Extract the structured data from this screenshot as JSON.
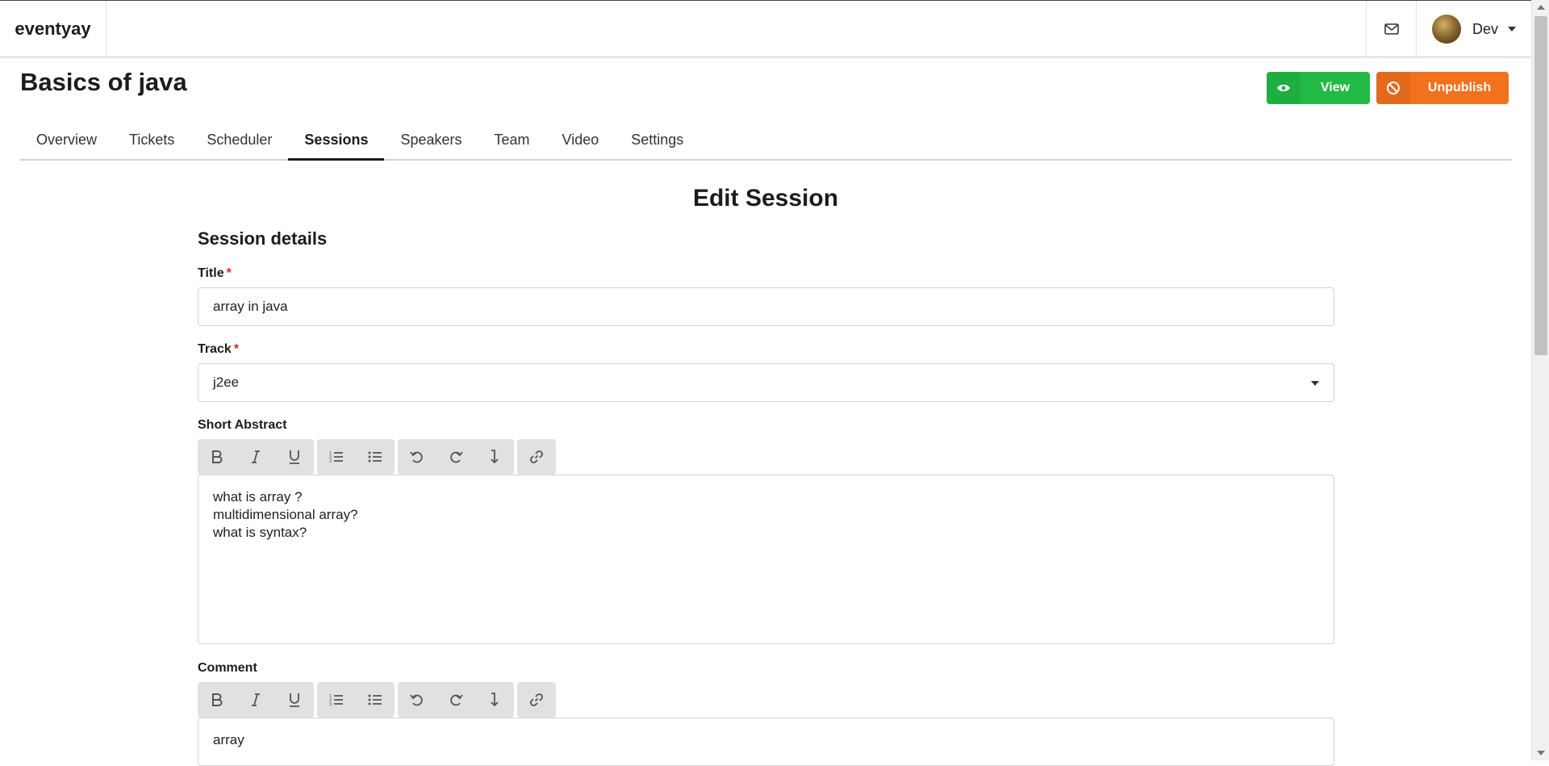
{
  "app": {
    "brand": "eventyay"
  },
  "user": {
    "name": "Dev"
  },
  "event": {
    "title": "Basics of java"
  },
  "actions": {
    "view_label": "View",
    "unpublish_label": "Unpublish"
  },
  "tabs": [
    {
      "label": "Overview"
    },
    {
      "label": "Tickets"
    },
    {
      "label": "Scheduler"
    },
    {
      "label": "Sessions",
      "active": true
    },
    {
      "label": "Speakers"
    },
    {
      "label": "Team"
    },
    {
      "label": "Video"
    },
    {
      "label": "Settings"
    }
  ],
  "form": {
    "heading": "Edit Session",
    "section": "Session details",
    "title_label": "Title",
    "title_value": "array in java",
    "track_label": "Track",
    "track_value": "j2ee",
    "abstract_label": "Short Abstract",
    "abstract_lines": [
      "what is array ?",
      "multidimensional array?",
      "what is syntax?"
    ],
    "comment_label": "Comment",
    "comment_value": "array",
    "required_mark": "*"
  },
  "colors": {
    "view": "#21ba45",
    "unpublish": "#f2711c",
    "required": "#db2828"
  },
  "icons": {
    "toolbar": [
      "bold-icon",
      "italic-icon",
      "underline-icon",
      "ordered-list-icon",
      "unordered-list-icon",
      "undo-icon",
      "redo-icon",
      "line-break-icon",
      "link-icon"
    ]
  }
}
